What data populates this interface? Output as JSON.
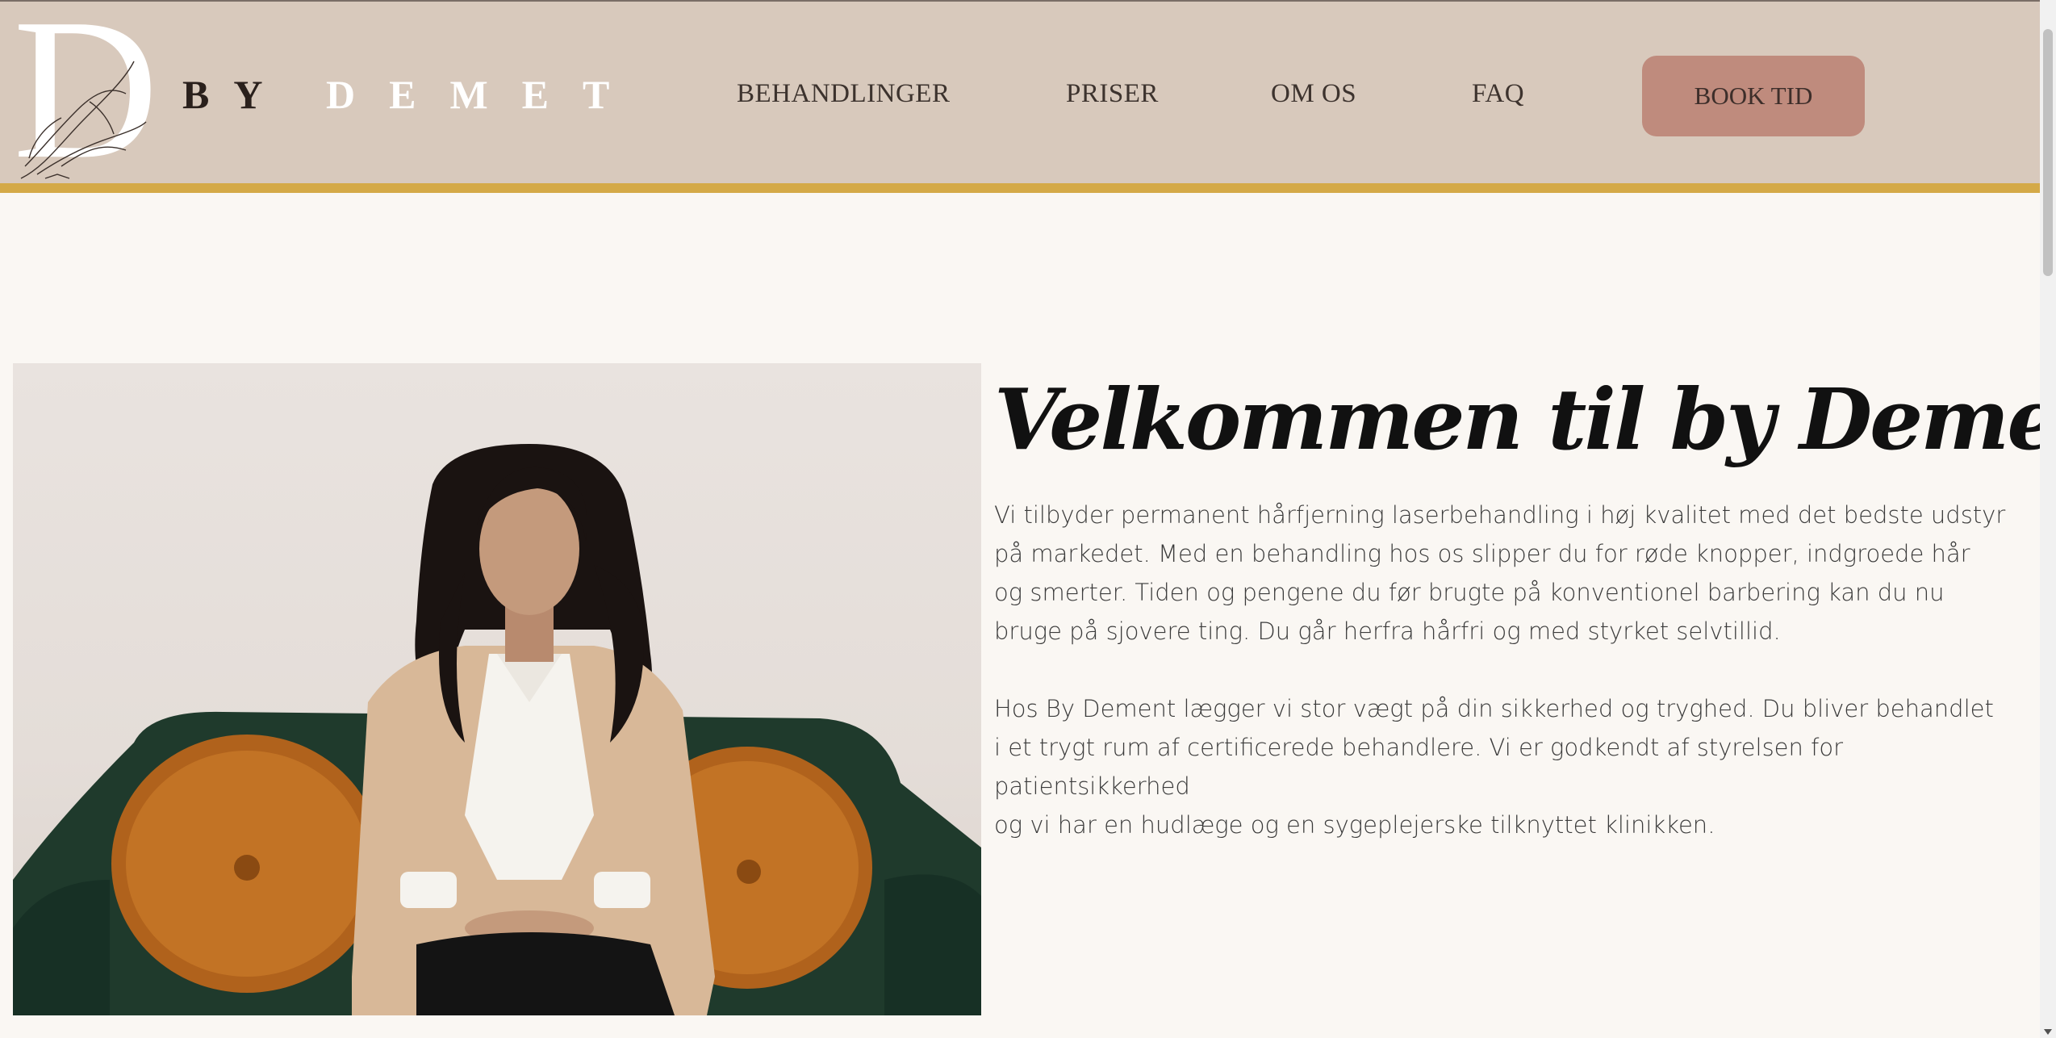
{
  "brand": {
    "letter": "D",
    "by": "BY",
    "name": "DEMET"
  },
  "nav": {
    "items": [
      {
        "label": "BEHANDLINGER"
      },
      {
        "label": "PRISER"
      },
      {
        "label": "OM OS"
      },
      {
        "label": "FAQ"
      }
    ],
    "cta": "BOOK TID"
  },
  "hero": {
    "title": "Velkommen til by Demet",
    "paragraph1": [
      "Vi tilbyder permanent hårfjerning laserbehandling i høj kvalitet med det bedste udstyr",
      "på markedet. Med en behandling hos os slipper du for røde knopper, indgroede hår",
      "og smerter. Tiden og pengene du før brugte på konventionel barbering kan du nu",
      "bruge på sjovere ting. Du går herfra hårfri og med styrket selvtillid."
    ],
    "paragraph2": [
      "Hos By Dement lægger vi stor vægt på din sikkerhed og tryghed. Du bliver behandlet",
      "i et trygt rum af certificerede behandlere. Vi er godkendt af styrelsen for patientsikkerhed",
      "og vi har en hudlæge og en sygeplejerske tilknyttet klinikken."
    ]
  },
  "colors": {
    "header_bg": "#d8c9bc",
    "accent_bar": "#d4a947",
    "cta_bg": "#bf8b7d",
    "page_bg": "#faf7f3"
  }
}
